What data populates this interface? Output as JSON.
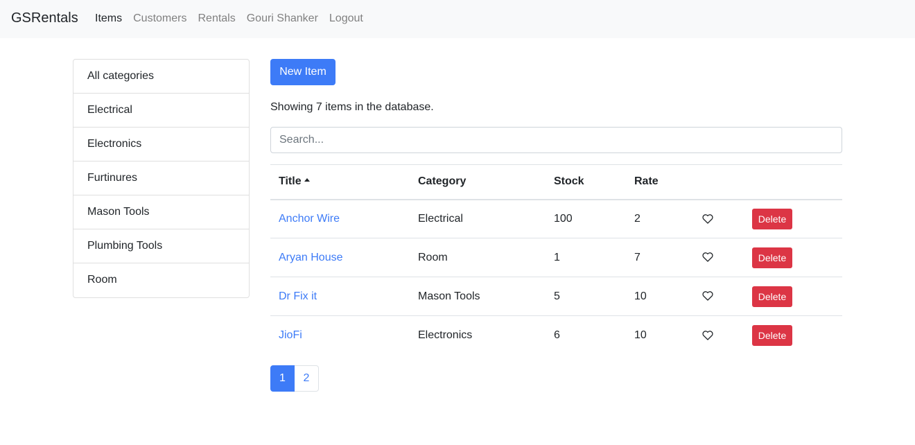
{
  "navbar": {
    "brand": "GSRentals",
    "links": [
      {
        "label": "Items",
        "active": true
      },
      {
        "label": "Customers",
        "active": false
      },
      {
        "label": "Rentals",
        "active": false
      },
      {
        "label": "Gouri Shanker",
        "active": false
      },
      {
        "label": "Logout",
        "active": false
      }
    ]
  },
  "sidebar": {
    "items": [
      "All categories",
      "Electrical",
      "Electronics",
      "Furtinures",
      "Mason Tools",
      "Plumbing Tools",
      "Room"
    ]
  },
  "main": {
    "new_button_label": "New Item",
    "count_text": "Showing 7 items in the database.",
    "search_placeholder": "Search...",
    "table": {
      "headers": {
        "title": "Title",
        "category": "Category",
        "stock": "Stock",
        "rate": "Rate"
      },
      "sort_icon": "caret-up-icon",
      "rows": [
        {
          "title": "Anchor Wire",
          "category": "Electrical",
          "stock": "100",
          "rate": "2",
          "delete_label": "Delete"
        },
        {
          "title": "Aryan House",
          "category": "Room",
          "stock": "1",
          "rate": "7",
          "delete_label": "Delete"
        },
        {
          "title": "Dr Fix it",
          "category": "Mason Tools",
          "stock": "5",
          "rate": "10",
          "delete_label": "Delete"
        },
        {
          "title": "JioFi",
          "category": "Electronics",
          "stock": "6",
          "rate": "10",
          "delete_label": "Delete"
        }
      ]
    },
    "pagination": {
      "pages": [
        "1",
        "2"
      ],
      "current": "1"
    }
  },
  "colors": {
    "primary": "#3d7bf7",
    "danger": "#dc3545",
    "navbar_bg": "#f8f9fa"
  }
}
